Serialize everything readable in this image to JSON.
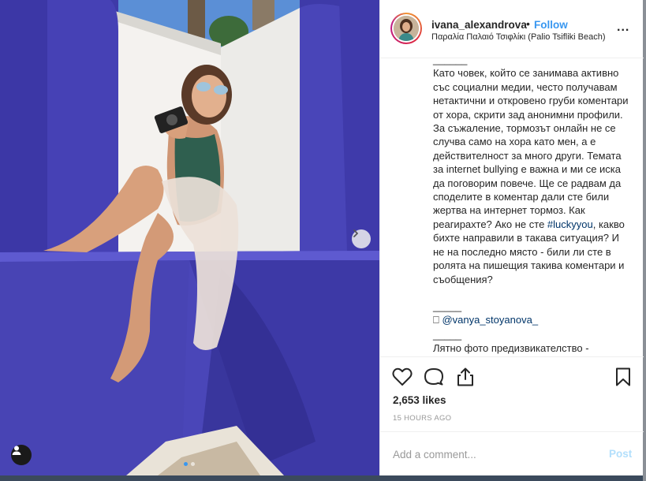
{
  "post": {
    "username": "ivana_alexandrova",
    "separator": "•",
    "follow_label": "Follow",
    "location": "Παραλία Παλαιό Τσιφλίκι (Palio Tsifliki Beach)",
    "more_label": "..."
  },
  "caption": {
    "divider_top": "______",
    "body": "Като човек, който се занимава активно със социални медии, често получавам нетактични и откровено груби коментари от хора, скрити зад анонимни профили. За съжаление, тормозът онлайн не се случва само на хора като мен, а е действителност за много други. Темата за internet bullying е важна и ми се иска да поговорим повече. Ще се радвам да споделите в коментар дали сте били жертва на интернет тормоз. Как реагирахте? Ако не сте",
    "hashtag": "#luckyyou",
    "body_end": ", какво бихте направили в такава ситуация? И не на последно място - били ли сте в ролята на пишещия такива коментари и съобщения?",
    "divider_mid": "_____",
    "mention_glyph": "⎕",
    "mention": "@vanya_stoyanova_",
    "divider_low": "_____",
    "cut_off_line": "Лятно фото предизвикателство -"
  },
  "engagement": {
    "likes": "2,653 likes",
    "timestamp": "15 HOURS AGO"
  },
  "comment": {
    "placeholder": "Add a comment...",
    "post_label": "Post"
  },
  "icons": {
    "like": "heart-icon",
    "comment": "comment-bubble-icon",
    "share": "share-icon",
    "save": "bookmark-icon",
    "next": "chevron-right-icon",
    "user_tags": "user-tag-icon"
  },
  "colors": {
    "follow": "#3897f0",
    "link": "#003569",
    "post_disabled": "#b2dffc",
    "wall_purple": "#4a46b8"
  }
}
